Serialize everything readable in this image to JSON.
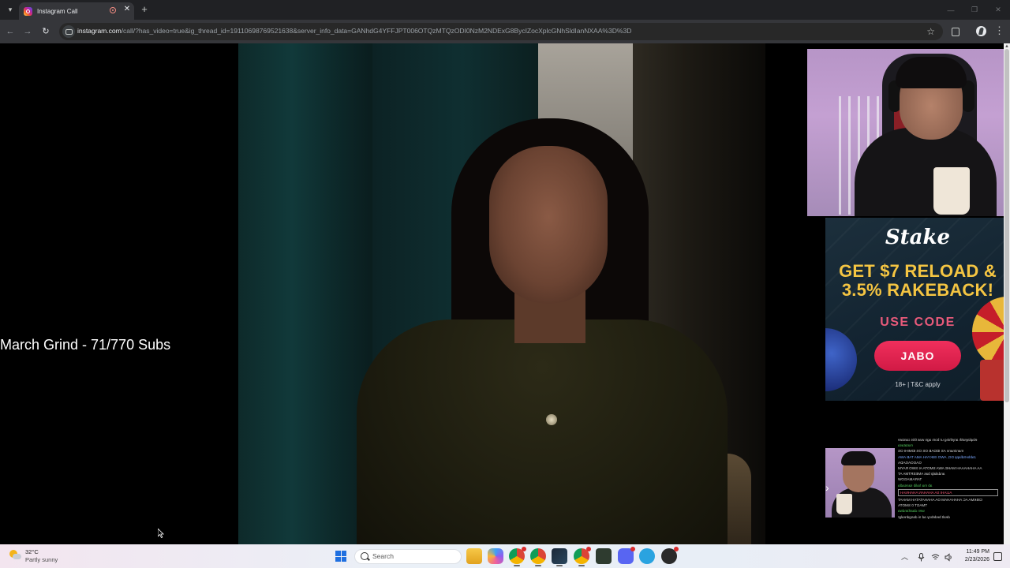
{
  "browser": {
    "tab_title": "Instagram Call",
    "new_tab_glyph": "+",
    "close_glyph": "✕",
    "url_host": "instagram.com",
    "url_path": "/call/?has_video=true&ig_thread_id=19110698769521638&server_info_data=GANhdG4YFFJPT006OTQzMTQzODI0NzM2NDExG8BycIZocXplcGNhSldIanNXAA%3D%3D",
    "icons": [
      "tab-search-icon",
      "instagram-icon",
      "recording-icon",
      "close-icon",
      "new-tab-icon",
      "minimize-icon",
      "maximize-icon",
      "window-close-icon",
      "back-icon",
      "forward-icon",
      "reload-icon",
      "site-info-icon",
      "bookmark-star-icon",
      "extensions-icon",
      "profile-icon",
      "menu-icon"
    ]
  },
  "stream": {
    "overlay_text": "March Grind - 71/770 Subs",
    "ad": {
      "logo": "Stake",
      "headline_line1": "GET $7 RELOAD &",
      "headline_line2": "3.5% RAKEBACK!",
      "use_code": "USE CODE",
      "code": "JABO",
      "fine_print": "18+ | T&C apply",
      "colors": {
        "headline": "#f5c542",
        "use_code": "#e85a7a",
        "button": "#e8264f"
      }
    },
    "chat_mirrored_lines": [
      "elaplaywith anything ur bom agn was this cantare",
      "matatasa",
      "manimann AS IDDAB OS OS IDMIHI OS",
      "JabbeSdlapp DO, AWO ISIKYAH AMA TAB AWA",
      "GAGOAGADA",
      "AA AHAHAAAH MAHE AWA SMOTA AI SWO RAYM",
      "andalalp bas AMEERTMA AT",
      "TARAMAGOW",
      "ab ma halib sansadla",
      "ALIAHI SA AHAHAN AHAHNAH",
      "CIBKMA AC AHAHAHAM OA AHAHATATAH MAHAT",
      "TMAGT 0 SMOTA",
      "wen daarfandwa",
      "dealt bedeboy ad ni dangdrealgr"
    ]
  },
  "taskbar": {
    "temperature": "32°C",
    "condition": "Partly sunny",
    "search_placeholder": "Search",
    "time": "11:49 PM",
    "date": "2/23/2026",
    "apps": [
      "file-explorer-icon",
      "copilot-icon",
      "chrome-icon",
      "chrome-icon",
      "steam-icon",
      "chrome-icon",
      "discord-bot-icon",
      "discord-icon",
      "telegram-icon",
      "recorder-icon"
    ],
    "tray": [
      "show-hidden-icons",
      "microphone-icon",
      "wifi-icon",
      "speaker-icon",
      "notification-icon"
    ]
  }
}
